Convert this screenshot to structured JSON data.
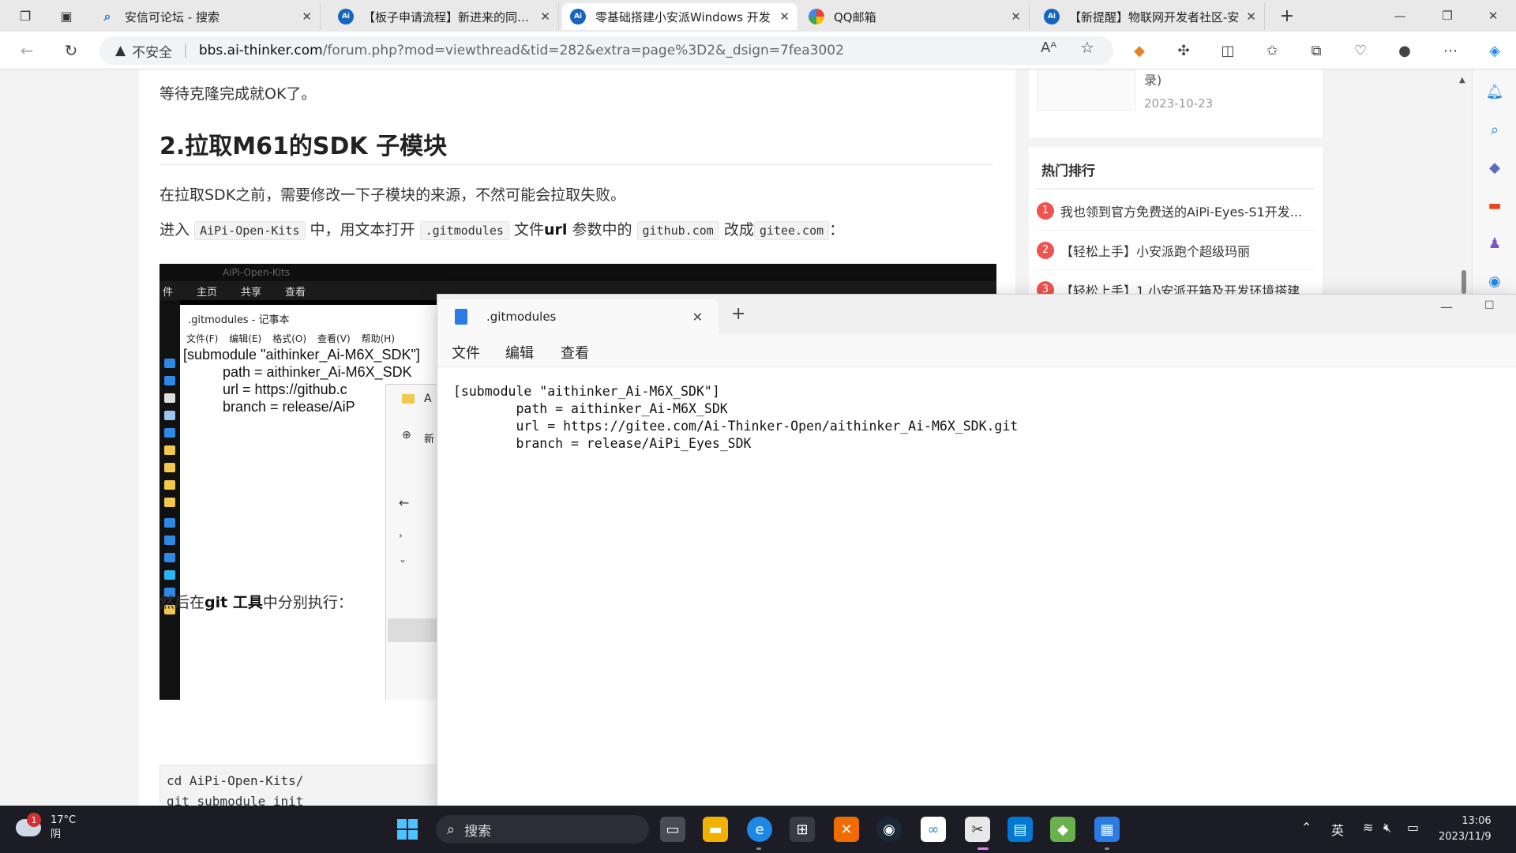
{
  "browser": {
    "tabs": [
      {
        "label": "安信可论坛 - 搜索",
        "icon": "search-icon"
      },
      {
        "label": "【板子申请流程】新进来的同学请",
        "icon": "ai-thinker-favicon"
      },
      {
        "label": "零基础搭建小安派Windows 开发",
        "icon": "ai-thinker-favicon",
        "active": true
      },
      {
        "label": "QQ邮箱",
        "icon": "qq-mail-favicon"
      },
      {
        "label": "【新提醒】物联网开发者社区-安",
        "icon": "ai-thinker-favicon"
      }
    ],
    "address": {
      "security_label": "不安全",
      "domain": "bbs.ai-thinker.com",
      "path": "/forum.php?mod=viewthread&tid=282&extra=page%3D2&_dsign=7fea3002"
    }
  },
  "article": {
    "para1": "等待克隆完成就OK了。",
    "heading": "2.拉取M61的SDK 子模块",
    "para2": "在拉取SDK之前，需要修改一下子模块的来源，不然可能会拉取失败。",
    "para3": {
      "t1": "进入",
      "c1": "AiPi-Open-Kits",
      "t2": " 中，用文本打开",
      "c2": ".gitmodules",
      "t3": " 文件",
      "b1": "url",
      "t4": " 参数中的",
      "c3": "github.com",
      "t5": " 改成",
      "c4": "gitee.com",
      "t6": "："
    },
    "para4": {
      "t1": "然后在",
      "b1": "git 工具",
      "t2": "中分别执行："
    },
    "code_lines": [
      "cd AiPi-Open-Kits/",
      "git submodule init"
    ],
    "screenshot": {
      "title": "AiPi-Open-Kits",
      "menu": [
        "件",
        "主页",
        "共享",
        "查看"
      ],
      "notepad_title": ".gitmodules - 记事本",
      "notepad_menu": [
        "文件(F)",
        "编辑(E)",
        "格式(O)",
        "查看(V)",
        "帮助(H)"
      ],
      "notepad_text": "[submodule \"aithinker_Ai-M6X_SDK\"]\n          path = aithinker_Ai-M6X_SDK\n          url = https://github.c\n          branch = release/AiP",
      "explorer_text1": "A",
      "explorer_text2": "新"
    }
  },
  "sidebar": {
    "latest": {
      "title": "录)",
      "date": "2023-10-23"
    },
    "hot": {
      "title": "热门排行",
      "items": [
        {
          "num": "1",
          "text": "我也领到官方免费送的AiPi-Eyes-S1开发..."
        },
        {
          "num": "2",
          "text": "【轻松上手】小安派跑个超级玛丽"
        },
        {
          "num": "3",
          "text": "【轻松上手】1.小安派开箱及开发环境搭建"
        }
      ]
    }
  },
  "notepad": {
    "tab_label": ".gitmodules",
    "menu": [
      "文件",
      "编辑",
      "查看"
    ],
    "content": "[submodule \"aithinker_Ai-M6X_SDK\"]\n        path = aithinker_Ai-M6X_SDK\n        url = https://gitee.com/Ai-Thinker-Open/aithinker_Ai-M6X_SDK.git\n        branch = release/AiPi_Eyes_SDK"
  },
  "taskbar": {
    "weather": {
      "temp": "17°C",
      "condition": "阴",
      "badge": "1"
    },
    "search_label": "搜索",
    "ime": "英",
    "time": "13:06",
    "date": "2023/11/9"
  },
  "colors": {
    "accent": "#1565c0",
    "hot_badge": "#ef5350",
    "taskbar": "#1c1c24"
  }
}
